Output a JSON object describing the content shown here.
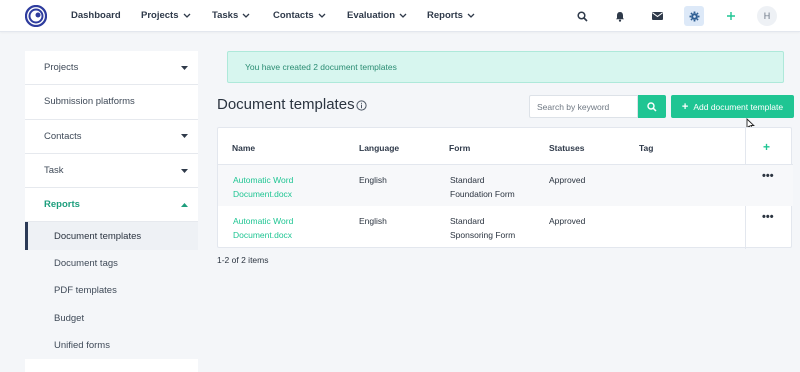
{
  "nav": {
    "items": [
      {
        "label": "Dashboard",
        "dropdown": false
      },
      {
        "label": "Projects",
        "dropdown": true
      },
      {
        "label": "Tasks",
        "dropdown": true
      },
      {
        "label": "Contacts",
        "dropdown": true
      },
      {
        "label": "Evaluation",
        "dropdown": true
      },
      {
        "label": "Reports",
        "dropdown": true
      }
    ],
    "icons": [
      "search-icon",
      "bell-icon",
      "mail-icon",
      "gear-icon",
      "plus-icon"
    ],
    "avatar_initial": "H"
  },
  "sidebar": {
    "items": [
      {
        "label": "Projects",
        "expandable": true
      },
      {
        "label": "Submission platforms",
        "expandable": false
      },
      {
        "label": "Contacts",
        "expandable": true
      },
      {
        "label": "Task",
        "expandable": true
      },
      {
        "label": "Reports",
        "expandable": true,
        "expanded": true
      }
    ],
    "subitems": [
      {
        "label": "Document templates",
        "current": true
      },
      {
        "label": "Document tags"
      },
      {
        "label": "PDF templates"
      },
      {
        "label": "Budget"
      },
      {
        "label": "Unified forms"
      }
    ]
  },
  "alert": {
    "text": "You have created 2 document templates"
  },
  "page": {
    "title": "Document templates",
    "search_placeholder": "Search by keyword",
    "add_label": "Add document template"
  },
  "table": {
    "columns": [
      "Name",
      "Language",
      "Form",
      "Statuses",
      "Tag"
    ],
    "rows": [
      {
        "name_line1": "Automatic Word",
        "name_line2": "Document.docx",
        "language": "English",
        "form_line1": "Standard",
        "form_line2": "Foundation Form",
        "status": "Approved",
        "tag": ""
      },
      {
        "name_line1": "Automatic Word",
        "name_line2": "Document.docx",
        "language": "English",
        "form_line1": "Standard",
        "form_line2": "Sponsoring Form",
        "status": "Approved",
        "tag": ""
      }
    ],
    "more_glyph": "•••",
    "add_column_glyph": "+"
  },
  "pager": {
    "text": "1-2 of 2 items"
  },
  "colors": {
    "accent": "#1fc593",
    "link": "#1fc593",
    "alert_bg": "#d7f6ef",
    "active_sidebar": "#2b3a57"
  }
}
